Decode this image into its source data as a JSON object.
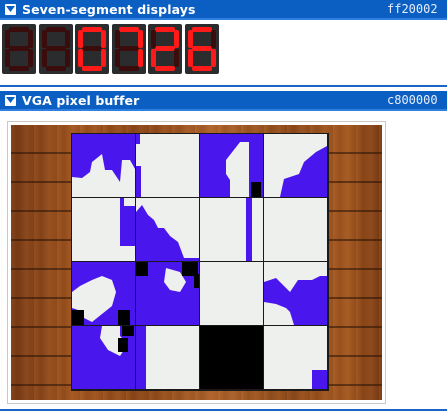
{
  "colors": {
    "header_bg": "#0b5fc2",
    "segment_on": "#ff1a1a",
    "segment_off": "#3b0c0c",
    "digit_bg": "#2a2c2e",
    "tile_light": "#eef0ee",
    "tile_blue": "#4a16ee",
    "tile_black": "#000000",
    "wood": "#a4561f"
  },
  "seven_segment_panel": {
    "title": "Seven-segment displays",
    "address": "ff20002",
    "toggle_icon": "triangle-down-icon",
    "digits": [
      "",
      "",
      "0",
      "7",
      "2",
      "6"
    ]
  },
  "vga_panel": {
    "title": "VGA pixel buffer",
    "address": "c800000",
    "toggle_icon": "triangle-down-icon"
  }
}
